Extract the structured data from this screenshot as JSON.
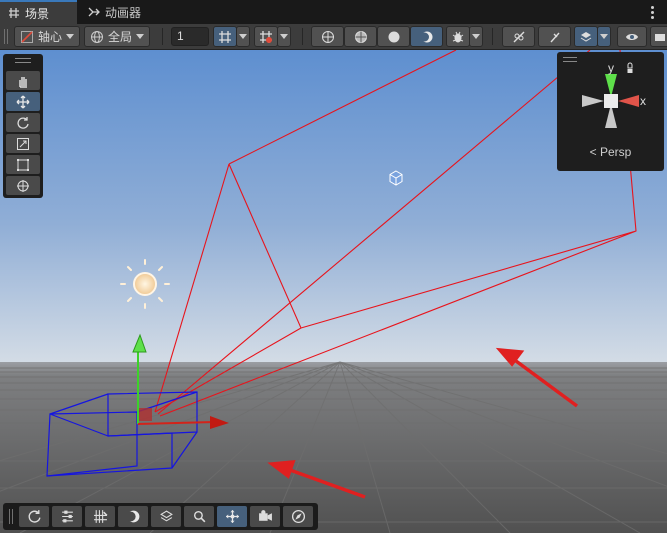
{
  "tabs": [
    {
      "label": "场景",
      "icon": "grid-icon",
      "active": true
    },
    {
      "label": "动画器",
      "icon": "animator-icon",
      "active": false
    }
  ],
  "toolbar": {
    "pivot_label": "轴心",
    "global_label": "全局",
    "grid_size_value": "1"
  },
  "scene_view": {
    "projection_label": "Persp",
    "gizmo_axes": {
      "y": "y",
      "x": "x"
    }
  },
  "tools": [
    "hand-tool",
    "move-tool",
    "rotate-tool",
    "scale-tool",
    "rect-tool",
    "transform-tool"
  ],
  "bottom_tools": [
    "orbit-icon",
    "sliders-icon",
    "grid-snap-icon",
    "shading-icon",
    "layers-icon",
    "search-icon",
    "move-tool-icon",
    "camera-icon",
    "compass-icon"
  ],
  "colors": {
    "accent": "#46607c",
    "frustum": "#e8141c",
    "bounds": "#1515e0",
    "y_axis": "#3dd12a",
    "x_axis": "#d3231a",
    "annotation_arrow": "#e02020"
  }
}
